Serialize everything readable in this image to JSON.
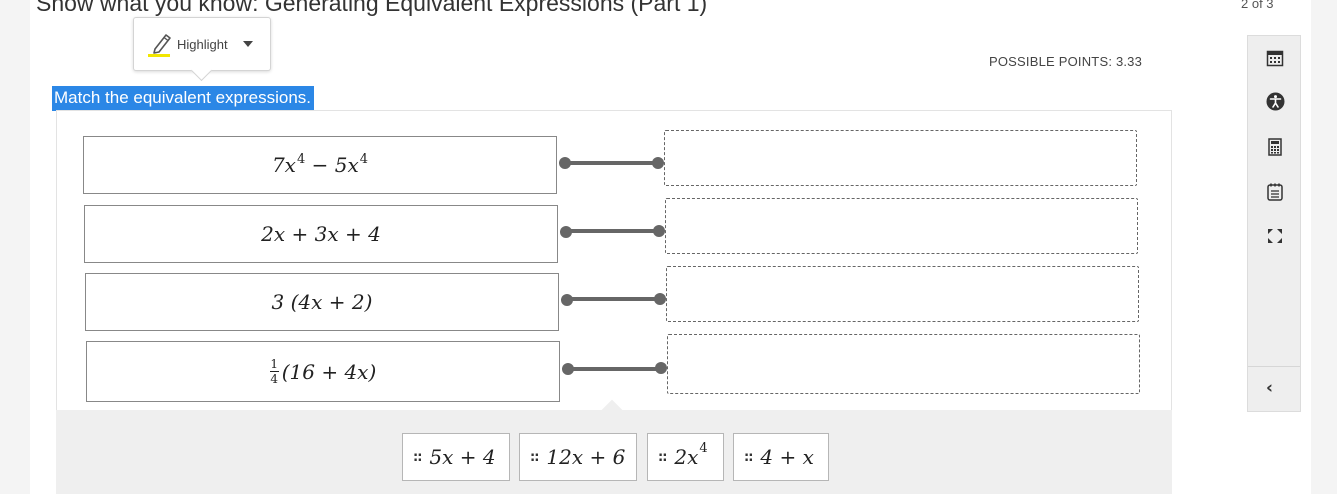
{
  "header": {
    "title": "Show what you know: Generating Equivalent Expressions (Part 1)",
    "progress": "2 of 3"
  },
  "highlight_tool": {
    "label": "Highlight"
  },
  "question": {
    "possible_points": "POSSIBLE POINTS: 3.33",
    "prompt": "Match the equivalent expressions.",
    "prompts": [
      {
        "a": "7x",
        "a_exp": "4",
        "op": "−",
        "b": "5x",
        "b_exp": "4"
      },
      {
        "text": "2x + 3x + 4"
      },
      {
        "text": "3 (4x + 2)"
      },
      {
        "frac_num": "1",
        "frac_den": "4",
        "text": "(16 + 4x)"
      }
    ],
    "answer_tiles": [
      {
        "text": "5x + 4"
      },
      {
        "text": "12x + 6"
      },
      {
        "base": "2x",
        "exp": "4"
      },
      {
        "text": "4 + x"
      }
    ]
  },
  "sidebar": {
    "tools": [
      "calendar-icon",
      "accessibility-icon",
      "calculator-icon",
      "notepad-icon",
      "fullscreen-icon"
    ],
    "collapse_label": "‹"
  },
  "colors": {
    "selection": "#2b87e6",
    "connector": "#666666",
    "tray": "#efefef",
    "sidebar": "#eeeeee"
  }
}
